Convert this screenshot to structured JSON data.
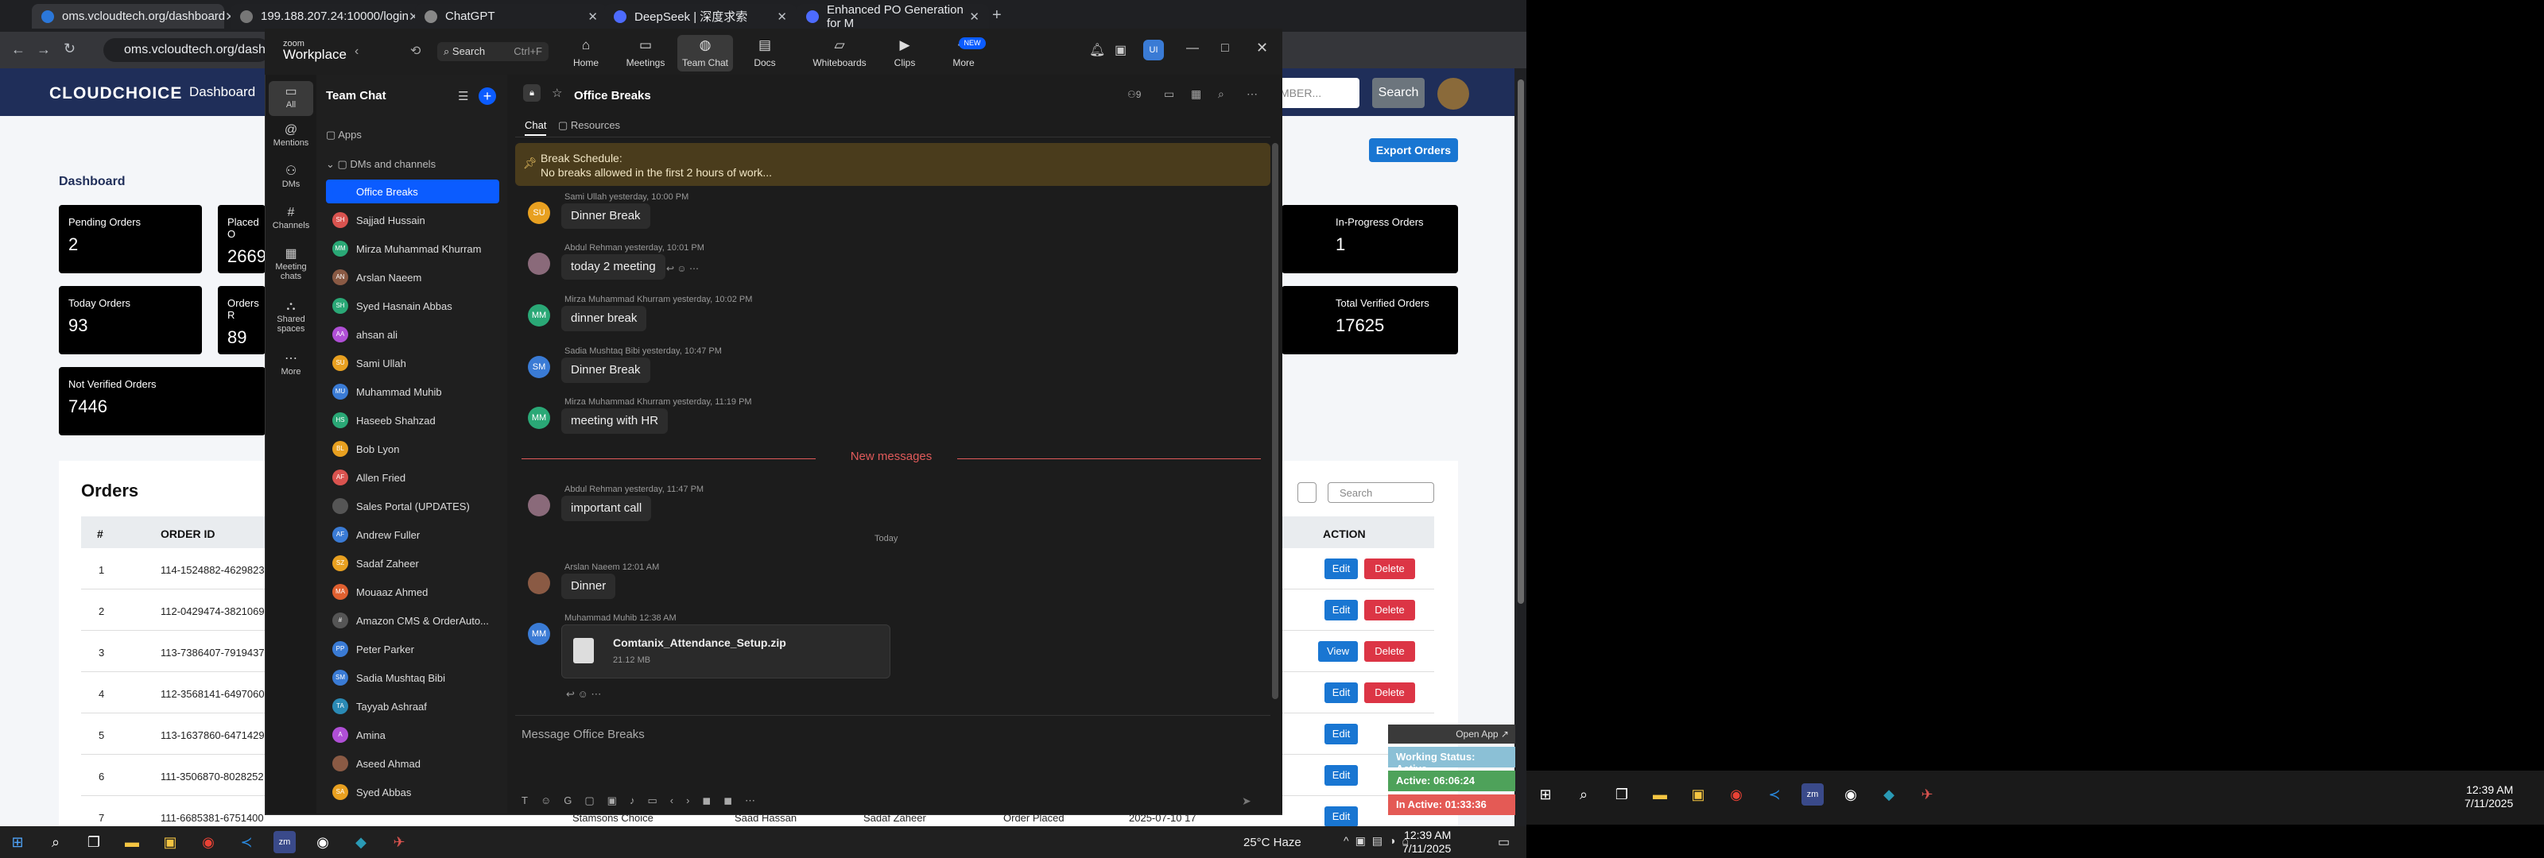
{
  "browser": {
    "tabs": [
      {
        "title": "oms.vcloudtech.org/dashboard",
        "color": "#2b77d9"
      },
      {
        "title": "199.188.207.24:10000/login",
        "color": "#777"
      },
      {
        "title": "ChatGPT",
        "color": "#888"
      },
      {
        "title": "DeepSeek | 深度求索",
        "color": "#4d6bfe"
      },
      {
        "title": "Enhanced PO Generation for M",
        "color": "#4d6bfe"
      }
    ],
    "address": "oms.vcloudtech.org/dashboard"
  },
  "web": {
    "brand": "CLOUDCHOICE",
    "nav_dashboard": "Dashboard",
    "search_placeholder": "MBER...",
    "search_button": "Search",
    "page_title": "Dashboard",
    "export_button": "Export Orders",
    "cards": [
      {
        "label": "Pending Orders",
        "value": "2"
      },
      {
        "label": "Placed O",
        "value": "2669"
      },
      {
        "label": "Today Orders",
        "value": "93"
      },
      {
        "label": "Orders R",
        "value": "89"
      },
      {
        "label": "Not Verified Orders",
        "value": "7446"
      },
      {
        "label": "In-Progress Orders",
        "value": "1"
      },
      {
        "label": "Total Verified Orders",
        "value": "17625"
      }
    ],
    "orders_title": "Orders",
    "orders_search_placeholder": "Search",
    "columns": {
      "num": "#",
      "order_id": "ORDER ID",
      "action": "ACTION"
    },
    "rows": [
      {
        "num": "1",
        "order_id": "114-1524882-4629823"
      },
      {
        "num": "2",
        "order_id": "112-0429474-3821069"
      },
      {
        "num": "3",
        "order_id": "113-7386407-7919437"
      },
      {
        "num": "4",
        "order_id": "112-3568141-6497060"
      },
      {
        "num": "5",
        "order_id": "113-1637860-6471429"
      },
      {
        "num": "6",
        "order_id": "111-3506870-8028252"
      },
      {
        "num": "7",
        "order_id": "111-6685381-6751400"
      }
    ],
    "btn_edit": "Edit",
    "btn_delete": "Delete",
    "btn_view": "View",
    "partial_row": {
      "vendor": "Stamsons Choice",
      "agent": "Saad Hassan",
      "assignee": "Sadaf Zaheer",
      "status": "Order Placed",
      "date": "2025-07-10 17"
    }
  },
  "zoom": {
    "logo_small": "zoom",
    "logo_big": "Workplace",
    "search": "Search",
    "search_shortcut": "Ctrl+F",
    "nav": [
      "Home",
      "Meetings",
      "Team Chat",
      "Docs",
      "Whiteboards",
      "Clips",
      "More"
    ],
    "new_badge": "NEW",
    "user_initials": "UI",
    "rail": [
      "All",
      "Mentions",
      "DMs",
      "Channels",
      "Meeting chats",
      "Shared spaces",
      "More"
    ],
    "team_chat": "Team Chat",
    "apps": "Apps",
    "dms_channels": "DMs and channels",
    "channels": [
      {
        "name": "Office Breaks",
        "initials": "",
        "color": "#0b5cff"
      },
      {
        "name": "Sajjad Hussain",
        "initials": "SH",
        "color": "#d9534f"
      },
      {
        "name": "Mirza Muhammad Khurram",
        "initials": "MM",
        "color": "#2aa876"
      },
      {
        "name": "Arslan Naeem",
        "initials": "AN",
        "color": "#8a5a44"
      },
      {
        "name": "Syed Hasnain Abbas",
        "initials": "SH",
        "color": "#2aa876"
      },
      {
        "name": "ahsan ali",
        "initials": "AA",
        "color": "#b04fd6"
      },
      {
        "name": "Sami Ullah",
        "initials": "SU",
        "color": "#e8a020"
      },
      {
        "name": "Muhammad Muhib",
        "initials": "MU",
        "color": "#3a7bd5"
      },
      {
        "name": "Haseeb Shahzad",
        "initials": "HS",
        "color": "#2aa876"
      },
      {
        "name": "Bob Lyon",
        "initials": "BL",
        "color": "#e8a020"
      },
      {
        "name": "Allen Fried",
        "initials": "AF",
        "color": "#d9534f"
      },
      {
        "name": "Sales Portal (UPDATES)",
        "initials": "",
        "color": "#555"
      },
      {
        "name": "Andrew Fuller",
        "initials": "AF",
        "color": "#3a7bd5"
      },
      {
        "name": "Sadaf Zaheer",
        "initials": "SZ",
        "color": "#e8a020"
      },
      {
        "name": "Mouaaz Ahmed",
        "initials": "MA",
        "color": "#e06030"
      },
      {
        "name": "Amazon CMS & OrderAuto...",
        "initials": "#",
        "color": "#555"
      },
      {
        "name": "Peter Parker",
        "initials": "PP",
        "color": "#3a7bd5"
      },
      {
        "name": "Sadia Mushtaq Bibi",
        "initials": "SM",
        "color": "#3a7bd5"
      },
      {
        "name": "Tayyab Ashraaf",
        "initials": "TA",
        "color": "#2a8ab5"
      },
      {
        "name": "Amina",
        "initials": "A",
        "color": "#b04fd6"
      },
      {
        "name": "Aseed Ahmad",
        "initials": "",
        "color": "#8a5a44"
      },
      {
        "name": "Syed Abbas",
        "initials": "SA",
        "color": "#e8a020"
      }
    ],
    "channel_title": "Office Breaks",
    "member_count": "9",
    "tab_chat": "Chat",
    "tab_resources": "Resources",
    "banner_title": "Break Schedule:",
    "banner_body": "No breaks allowed in the first 2 hours of work...",
    "messages": [
      {
        "initials": "SU",
        "color": "#e8a020",
        "meta": "Sami Ullah yesterday, 10:00 PM",
        "text": "Dinner Break"
      },
      {
        "initials": "",
        "color": "#8a6a7a",
        "meta": "Abdul Rehman yesterday, 10:01 PM",
        "text": "today 2 meeting"
      },
      {
        "initials": "MM",
        "color": "#2aa876",
        "meta": "Mirza Muhammad Khurram yesterday, 10:02 PM",
        "text": "dinner break"
      },
      {
        "initials": "SM",
        "color": "#3a7bd5",
        "meta": "Sadia Mushtaq Bibi yesterday, 10:47 PM",
        "text": "Dinner Break"
      },
      {
        "initials": "MM",
        "color": "#2aa876",
        "meta": "Mirza Muhammad Khurram yesterday, 11:19 PM",
        "text": "meeting with HR"
      },
      {
        "initials": "",
        "color": "#8a6a7a",
        "meta": "Abdul Rehman yesterday, 11:47 PM",
        "text": "important call"
      },
      {
        "initials": "",
        "color": "#8a5a44",
        "meta": "Arslan Naeem 12:01 AM",
        "text": "Dinner"
      },
      {
        "initials": "MM",
        "color": "#3a7bd5",
        "meta": "Muhammad Muhib 12:38 AM",
        "text": ""
      }
    ],
    "new_messages": "New messages",
    "today": "Today",
    "file_name": "Comtanix_Attendance_Setup.zip",
    "file_size": "21.12 MB",
    "compose_placeholder": "Message Office Breaks"
  },
  "widget": {
    "open_app": "Open App ↗",
    "status": "Working Status: Active",
    "active": "Active: 06:06:24",
    "inactive": "In Active: 01:33:36"
  },
  "taskbar_left": {
    "weather": "25°C Haze",
    "time": "12:39 AM",
    "date": "7/11/2025"
  },
  "taskbar_right": {
    "time": "12:39 AM",
    "date": "7/11/2025"
  }
}
